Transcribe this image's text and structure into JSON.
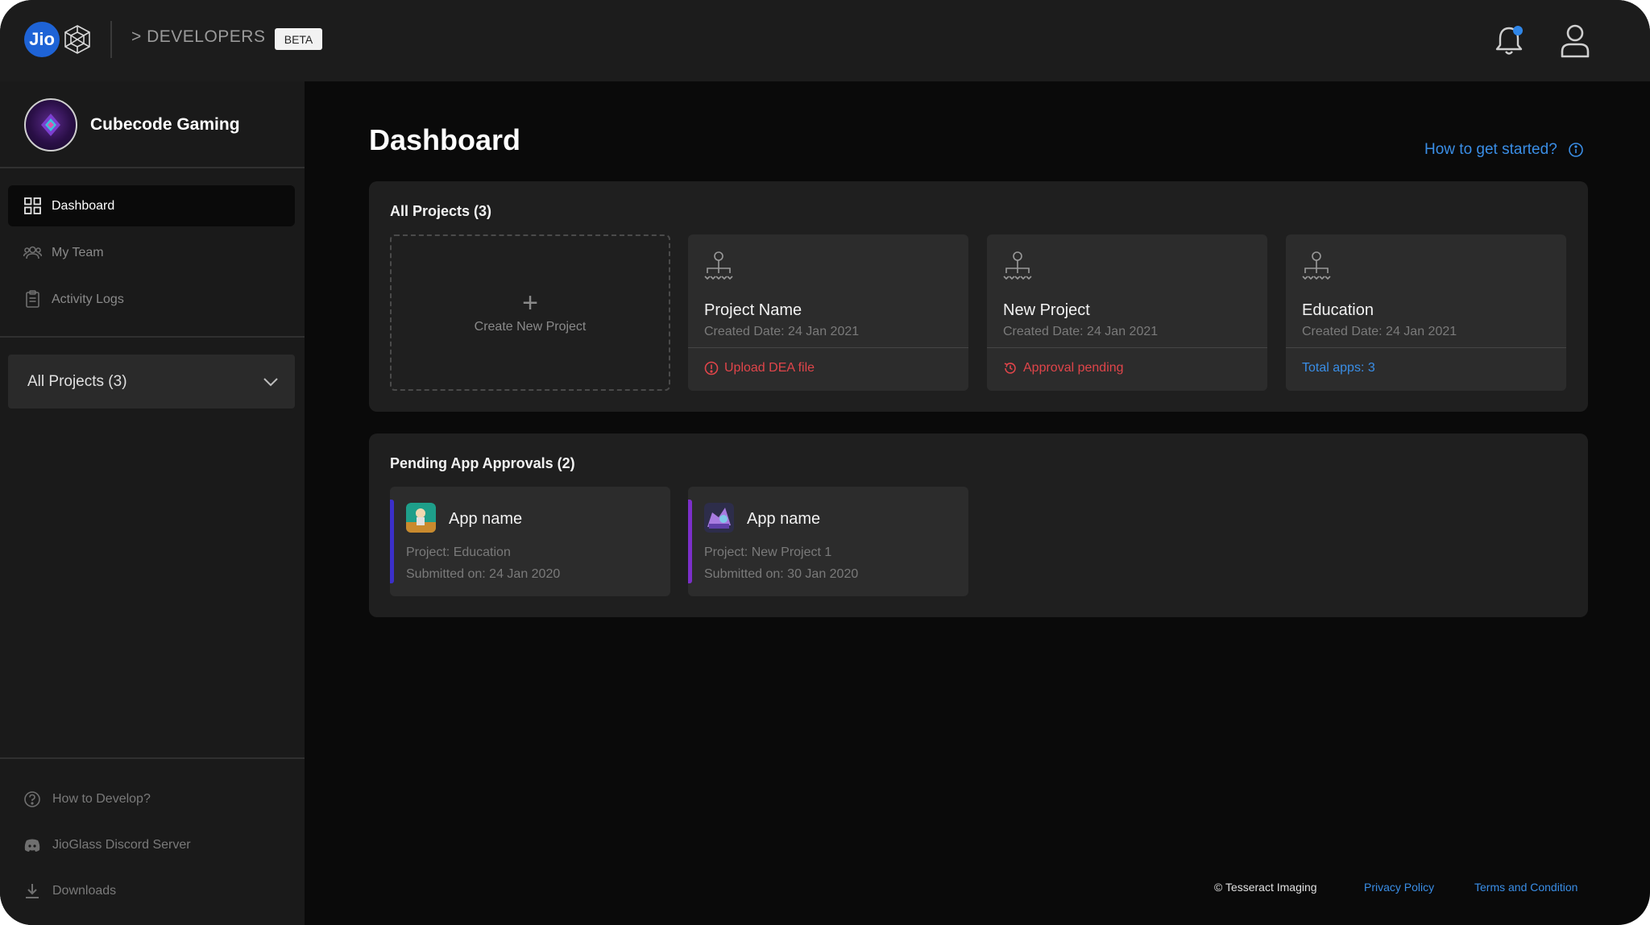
{
  "header": {
    "logo_text": "Jio",
    "section_label": "> DEVELOPERS",
    "beta_label": "BETA",
    "notification_count": "1"
  },
  "sidebar": {
    "org_name": "Cubecode Gaming",
    "nav": [
      {
        "label": "Dashboard",
        "icon": "grid-icon",
        "active": true
      },
      {
        "label": "My Team",
        "icon": "team-icon",
        "active": false
      },
      {
        "label": "Activity Logs",
        "icon": "clipboard-icon",
        "active": false
      }
    ],
    "project_selector": {
      "label": "All Projects (3)"
    },
    "bottom": [
      {
        "label": "How to Develop?",
        "icon": "help-icon"
      },
      {
        "label": "JioGlass Discord Server",
        "icon": "discord-icon"
      },
      {
        "label": "Downloads",
        "icon": "download-icon"
      }
    ]
  },
  "main": {
    "title": "Dashboard",
    "help_link": "How to get started?",
    "projects_panel": {
      "title": "All Projects (3)",
      "create_label": "Create New Project",
      "projects": [
        {
          "name": "Project Name",
          "created": "Created Date: 24 Jan 2021",
          "status": "Upload DEA file",
          "status_type": "error"
        },
        {
          "name": "New Project",
          "created": "Created Date: 24 Jan 2021",
          "status": "Approval pending",
          "status_type": "pending"
        },
        {
          "name": "Education",
          "created": "Created Date: 24 Jan 2021",
          "status": "Total apps: 3",
          "status_type": "info"
        }
      ]
    },
    "approvals_panel": {
      "title": "Pending App Approvals (2)",
      "apps": [
        {
          "name": "App name",
          "project": "Project: Education",
          "submitted": "Submitted on: 24 Jan 2020",
          "accent": "#3b2fc9"
        },
        {
          "name": "App name",
          "project": "Project: New Project 1",
          "submitted": "Submitted on: 30 Jan 2020",
          "accent": "#7b2fc9"
        }
      ]
    }
  },
  "footer": {
    "copyright": "© Tesseract Imaging",
    "privacy": "Privacy Policy",
    "terms": "Terms and Condition"
  },
  "colors": {
    "link": "#3a8ee6",
    "error": "#e0454a"
  }
}
